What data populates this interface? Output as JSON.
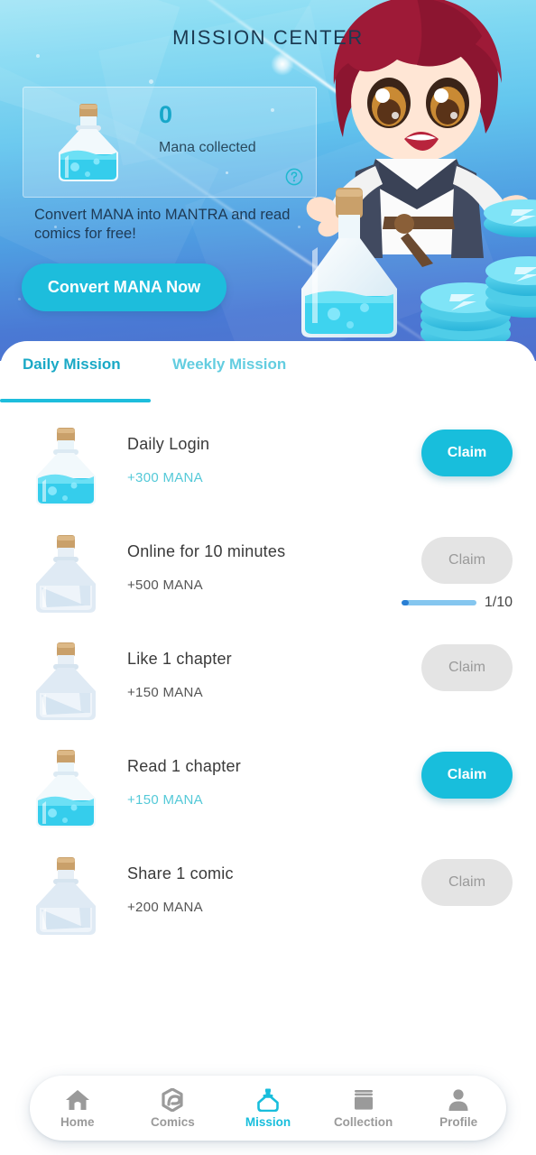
{
  "header": {
    "title": "MISSION CENTER",
    "mana_card": {
      "count": "0",
      "label": "Mana collected",
      "potion_icon": "potion-full-icon",
      "help_icon": "help-circle-icon"
    },
    "promo_text": "Convert MANA into MANTRA and read comics for free!",
    "convert_button": "Convert MANA Now",
    "hero_art": "chibi-character-with-potion-and-coins"
  },
  "tabs": [
    {
      "label": "Daily Mission",
      "active": true
    },
    {
      "label": "Weekly Mission",
      "active": false
    }
  ],
  "missions": [
    {
      "title": "Daily Login",
      "reward": "+300 MANA",
      "claimable": true,
      "potion_icon": "potion-full-icon",
      "claim_label": "Claim",
      "progress": null
    },
    {
      "title": "Online for 10 minutes",
      "reward": "+500 MANA",
      "claimable": false,
      "potion_icon": "potion-empty-icon",
      "claim_label": "Claim",
      "progress": {
        "current": 1,
        "total": 10,
        "text": "1/10",
        "percent": 10
      }
    },
    {
      "title": "Like 1 chapter",
      "reward": "+150 MANA",
      "claimable": false,
      "potion_icon": "potion-empty-icon",
      "claim_label": "Claim",
      "progress": null
    },
    {
      "title": "Read 1 chapter",
      "reward": "+150 MANA",
      "claimable": true,
      "potion_icon": "potion-full-icon",
      "claim_label": "Claim",
      "progress": null
    },
    {
      "title": "Share 1 comic",
      "reward": "+200 MANA",
      "claimable": false,
      "potion_icon": "potion-empty-icon",
      "claim_label": "Claim",
      "progress": null
    }
  ],
  "bottom_nav": [
    {
      "label": "Home",
      "icon": "home-icon",
      "active": false
    },
    {
      "label": "Comics",
      "icon": "comics-icon",
      "active": false
    },
    {
      "label": "Mission",
      "icon": "potion-icon",
      "active": true
    },
    {
      "label": "Collection",
      "icon": "collection-icon",
      "active": false
    },
    {
      "label": "Profile",
      "icon": "person-icon",
      "active": false
    }
  ],
  "colors": {
    "accent": "#18bedc",
    "accent_dark": "#1aa9c6",
    "tab_inactive": "#63cde0",
    "disabled_bg": "#e4e4e4",
    "disabled_text": "#9a9a9a",
    "progress_fill": "#2a7fd4",
    "progress_track": "#85c6ef",
    "title_text": "#1b3a52"
  }
}
